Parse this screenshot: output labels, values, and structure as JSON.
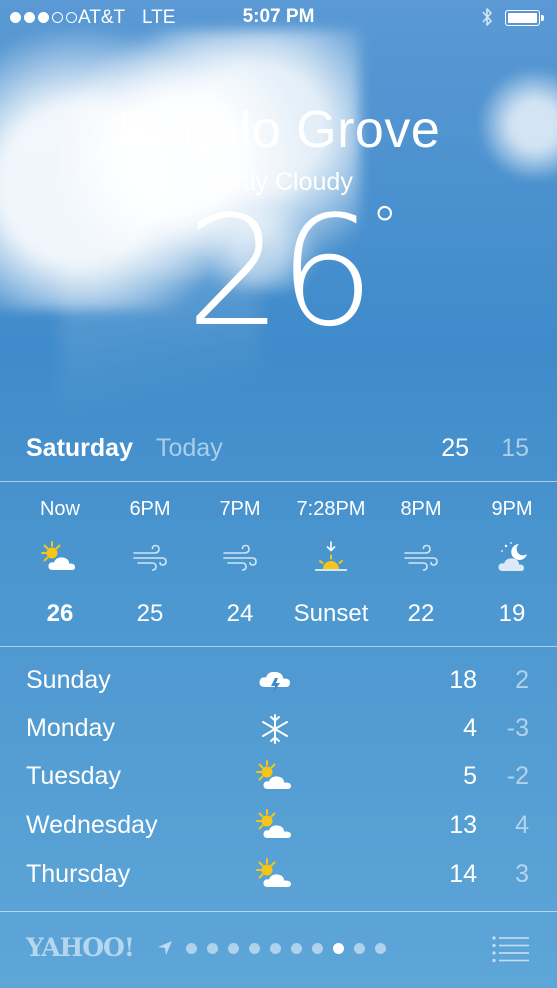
{
  "status_bar": {
    "carrier": "AT&T",
    "network": "LTE",
    "time": "5:07 PM",
    "signal_bars": 3,
    "signal_total": 5,
    "icons": [
      "bluetooth-icon",
      "battery-icon"
    ],
    "battery_level": 1.0
  },
  "location": {
    "city": "Buffalo Grove",
    "condition": "Partly Cloudy",
    "temperature": "26",
    "degree_sign": "°"
  },
  "today": {
    "day": "Saturday",
    "label": "Today",
    "high": "25",
    "low": "15"
  },
  "hourly": [
    {
      "time": "Now",
      "icon": "partly-cloudy-icon",
      "value": "26",
      "bold": true
    },
    {
      "time": "6PM",
      "icon": "wind-icon",
      "value": "25"
    },
    {
      "time": "7PM",
      "icon": "wind-icon",
      "value": "24"
    },
    {
      "time": "7:28PM",
      "icon": "sunset-icon",
      "value": "Sunset"
    },
    {
      "time": "8PM",
      "icon": "wind-icon",
      "value": "22"
    },
    {
      "time": "9PM",
      "icon": "night-partly-cloudy-icon",
      "value": "19"
    }
  ],
  "daily": [
    {
      "day": "Sunday",
      "icon": "thunderstorm-icon",
      "high": "18",
      "low": "2"
    },
    {
      "day": "Monday",
      "icon": "snowflake-icon",
      "high": "4",
      "low": "-3"
    },
    {
      "day": "Tuesday",
      "icon": "partly-cloudy-icon",
      "high": "5",
      "low": "-2"
    },
    {
      "day": "Wednesday",
      "icon": "partly-cloudy-icon",
      "high": "13",
      "low": "4"
    },
    {
      "day": "Thursday",
      "icon": "partly-cloudy-icon",
      "high": "14",
      "low": "3"
    }
  ],
  "bottom_bar": {
    "provider": "YAHOO!",
    "page_count": 10,
    "active_page": 7,
    "icons": [
      "location-arrow-icon",
      "list-icon"
    ]
  },
  "colors": {
    "sun": "#f5c518",
    "text": "#ffffff",
    "muted": "rgba(255,255,255,0.55)"
  }
}
